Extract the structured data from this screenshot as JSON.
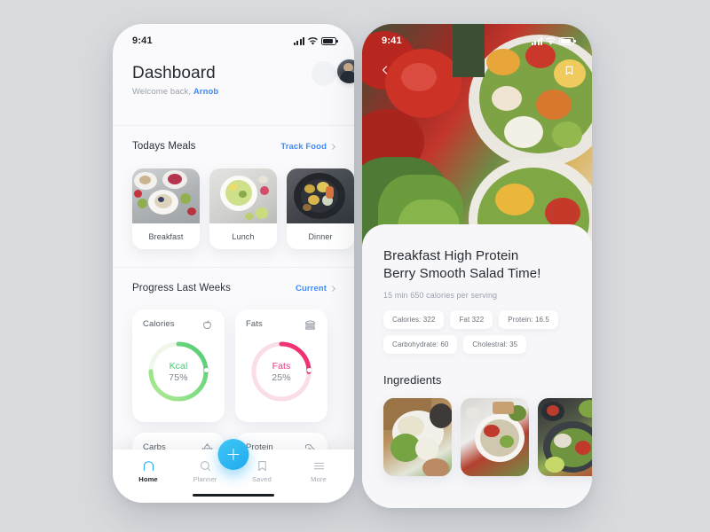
{
  "background_color": "#d9dbde",
  "accent_blue": "#3d8bfd",
  "left_phone": {
    "status_bar": {
      "time": "9:41",
      "icons": [
        "signal-icon",
        "wifi-icon",
        "battery-icon"
      ]
    },
    "header": {
      "title": "Dashboard",
      "welcome_prefix": "Welcome back, ",
      "user_name": "Arnob",
      "avatar": "user-avatar"
    },
    "meals_section": {
      "title": "Todays Meals",
      "link_label": "Track Food",
      "cards": [
        {
          "label": "Breakfast",
          "image": "breakfast-photo"
        },
        {
          "label": "Lunch",
          "image": "lunch-photo"
        },
        {
          "label": "Dinner",
          "image": "dinner-photo"
        }
      ]
    },
    "progress_section": {
      "title": "Progress Last Weeks",
      "link_label": "Current",
      "cards": [
        {
          "name": "Calories",
          "icon": "apple-icon",
          "ring_label": "Kcal",
          "ring_value": "75%",
          "percent": 75,
          "color": "#5fd37a",
          "color_light": "#a8e88f",
          "track": "#eef6ec"
        },
        {
          "name": "Fats",
          "icon": "burger-icon",
          "ring_label": "Fats",
          "ring_value": "25%",
          "percent": 25,
          "color": "#f0367f",
          "color_light": "#f8a8c4",
          "track": "#fbdce7"
        },
        {
          "name": "Carbs",
          "icon": "rice-bowl-icon"
        },
        {
          "name": "Protein",
          "icon": "bicep-icon"
        }
      ]
    },
    "tabbar": {
      "items": [
        {
          "label": "Home",
          "icon": "home-icon",
          "active": true
        },
        {
          "label": "Planner",
          "icon": "search-icon",
          "active": false
        },
        {
          "label": "Saved",
          "icon": "bookmark-icon",
          "active": false
        },
        {
          "label": "More",
          "icon": "menu-icon",
          "active": false
        }
      ],
      "fab": "add-button"
    }
  },
  "right_phone": {
    "status_bar": {
      "time": "9:41",
      "icons": [
        "signal-icon",
        "wifi-icon",
        "battery-icon"
      ]
    },
    "hero": {
      "image": "salad-tomato-photo",
      "back_icon": "chevron-left-icon",
      "bookmark_icon": "bookmark-icon"
    },
    "recipe": {
      "title_line1": "Breakfast High Protein",
      "title_line2": "Berry Smooth Salad Time!",
      "meta": "15 min 650 calories per serving",
      "chips": [
        "Calories: 322",
        "Fat 322",
        "Protein: 16.5",
        "Carbohydrate: 60",
        "Cholestral: 35"
      ]
    },
    "ingredients": {
      "title": "Ingredients",
      "cards": [
        {
          "image": "ingredient-photo-1"
        },
        {
          "image": "ingredient-photo-2"
        },
        {
          "image": "ingredient-photo-3"
        }
      ]
    }
  }
}
